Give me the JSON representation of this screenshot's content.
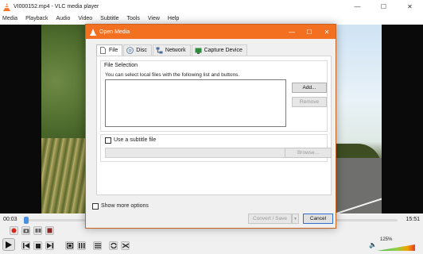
{
  "window": {
    "title": "VI000152.mp4 - VLC media player",
    "controls": {
      "minimize": "—",
      "maximize": "☐",
      "close": "✕"
    }
  },
  "menu": [
    "Media",
    "Playback",
    "Audio",
    "Video",
    "Subtitle",
    "Tools",
    "View",
    "Help"
  ],
  "player": {
    "time_elapsed": "00:03",
    "time_total": "15:51",
    "volume": "125%",
    "progress": 0.003
  },
  "dialog": {
    "title": "Open Media",
    "tabs": [
      "File",
      "Disc",
      "Network",
      "Capture Device"
    ],
    "active_tab": "File",
    "file_selection_label": "File Selection",
    "file_hint": "You can select local files with the following list and buttons.",
    "add_button": "Add...",
    "remove_button": "Remove",
    "subtitle_checkbox": "Use a subtitle file",
    "browse_button": "Browse...",
    "show_more": "Show more options",
    "convert_button": "Convert / Save",
    "convert_arrow": "▼",
    "cancel_button": "Cancel"
  },
  "colors": {
    "dialog_accent": "#f37021",
    "seek_handle": "#4a90e2"
  }
}
